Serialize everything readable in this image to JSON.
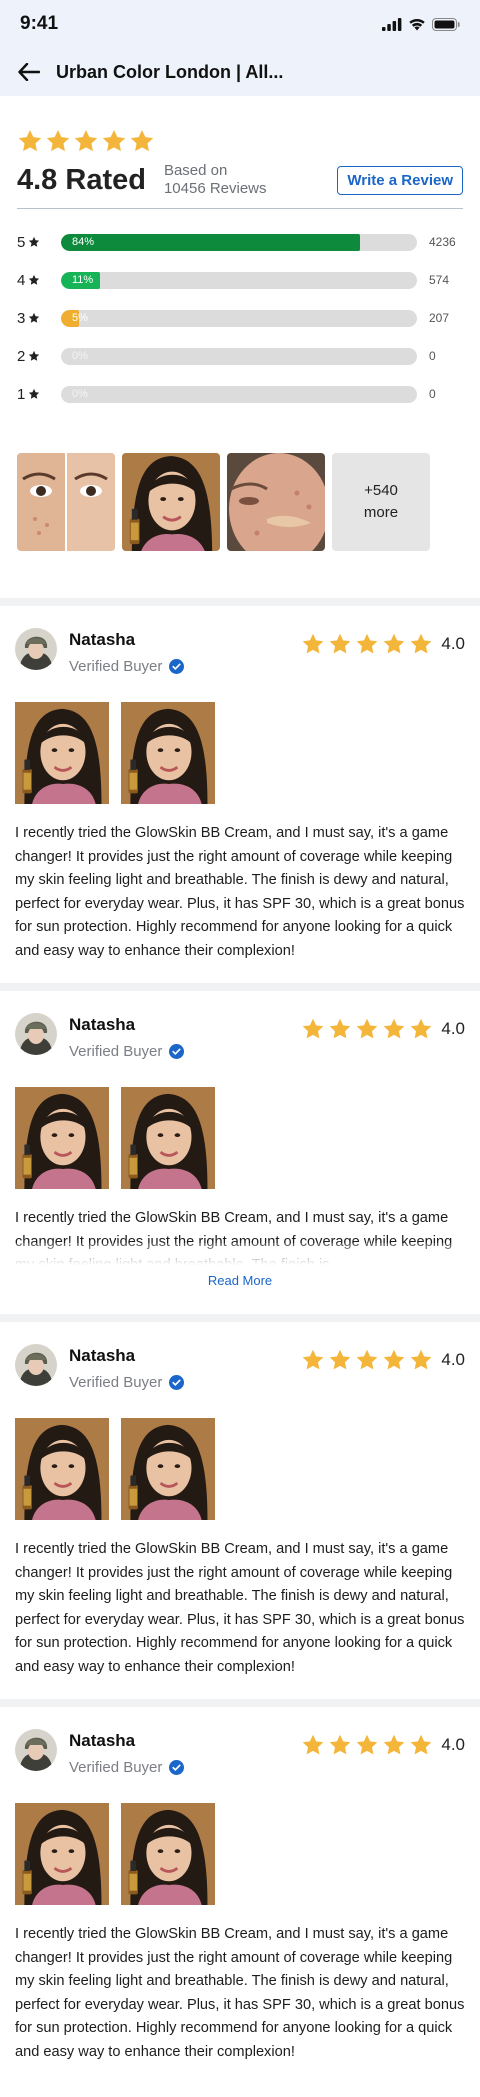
{
  "status_bar": {
    "time": "9:41"
  },
  "nav": {
    "title": "Urban Color London | All..."
  },
  "summary": {
    "rating_text": "4.8 Rated",
    "based_on_line1": "Based on",
    "based_on_line2": "10456 Reviews",
    "write_review_label": "Write a Review",
    "rating_value": 4.8
  },
  "distribution": [
    {
      "stars": "5",
      "percent": 84,
      "percent_label": "84%",
      "count": "4236",
      "color": "#0d8a3c"
    },
    {
      "stars": "4",
      "percent": 11,
      "percent_label": "11%",
      "count": "574",
      "color": "#17b457"
    },
    {
      "stars": "3",
      "percent": 5,
      "percent_label": "5%",
      "count": "207",
      "color": "#f0ae30"
    },
    {
      "stars": "2",
      "percent": 0,
      "percent_label": "0%",
      "count": "0",
      "color": "#dcdcdc"
    },
    {
      "stars": "1",
      "percent": 0,
      "percent_label": "0%",
      "count": "0",
      "color": "#dcdcdc"
    }
  ],
  "photos": {
    "more_line1": "+540",
    "more_line2": "more"
  },
  "reviews": [
    {
      "name": "Natasha",
      "verified_label": "Verified Buyer",
      "rating": "4.0",
      "text": "I recently tried the GlowSkin BB Cream, and I must say, it's a game changer! It provides just the right amount of coverage while keeping my skin feeling light and breathable. The finish is dewy and natural, perfect for everyday wear. Plus, it has SPF 30, which is a great bonus for sun protection. Highly recommend for anyone looking for a quick and easy way to enhance their complexion!"
    },
    {
      "name": "Natasha",
      "verified_label": "Verified Buyer",
      "rating": "4.0",
      "text": "I recently tried the GlowSkin BB Cream, and I must say, it's a game changer! It provides just the right amount of coverage while keeping my skin feeling light and breathable. The finish is",
      "read_more_label": "Read More"
    },
    {
      "name": "Natasha",
      "verified_label": "Verified Buyer",
      "rating": "4.0",
      "text": "I recently tried the GlowSkin BB Cream, and I must say, it's a game changer! It provides just the right amount of coverage while keeping my skin feeling light and breathable. The finish is dewy and natural, perfect for everyday wear. Plus, it has SPF 30, which is a great bonus for sun protection. Highly recommend for anyone looking for a quick and easy way to enhance their complexion!"
    },
    {
      "name": "Natasha",
      "verified_label": "Verified Buyer",
      "rating": "4.0",
      "text": "I recently tried the GlowSkin BB Cream, and I must say, it's a game changer! It provides just the right amount of coverage while keeping my skin feeling light and breathable. The finish is dewy and natural, perfect for everyday wear. Plus, it has SPF 30, which is a great bonus for sun protection. Highly recommend for anyone looking for a quick and easy way to enhance their complexion!"
    }
  ],
  "colors": {
    "star": "#f4b63a",
    "accent": "#1b66c9",
    "verified": "#1b66c9",
    "topbar": "#eef3fb"
  },
  "icons": {
    "back": "arrow-left-icon",
    "star": "star-icon",
    "verified": "verified-check-icon",
    "signal": "cellular-signal-icon",
    "wifi": "wifi-icon",
    "battery": "battery-icon"
  }
}
